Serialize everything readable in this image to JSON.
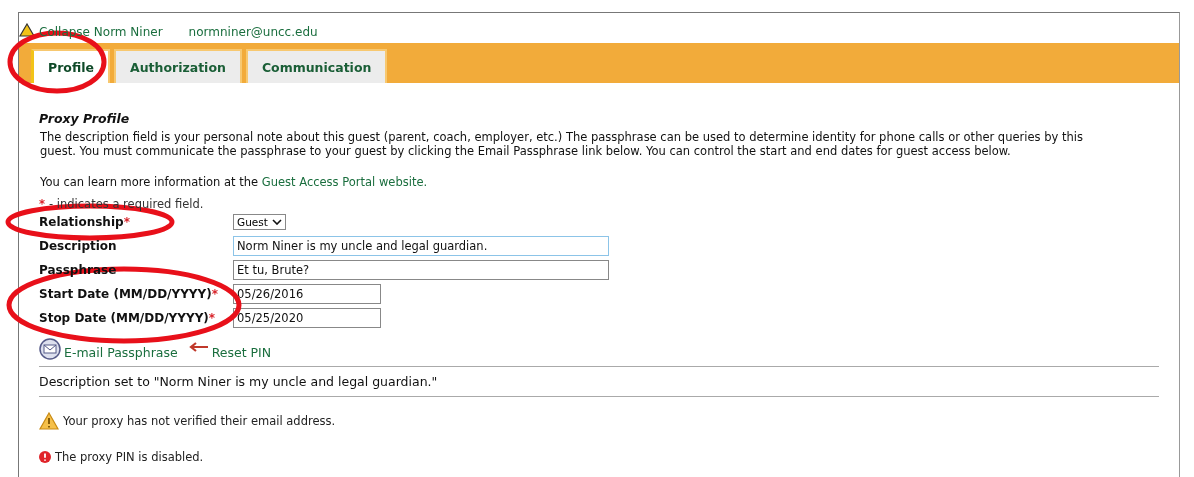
{
  "header": {
    "collapse_label": "Collapse Norm Niner",
    "email": "normniner@uncc.edu"
  },
  "tabs": [
    {
      "label": "Profile",
      "selected": true
    },
    {
      "label": "Authorization",
      "selected": false
    },
    {
      "label": "Communication",
      "selected": false
    }
  ],
  "section_title": "Proxy Profile",
  "intro": "The description field is your personal note about this guest (parent, coach, employer, etc.) The passphrase can be used to determine identity for phone calls or other queries by this guest. You must communicate the passphrase to your guest by clicking the Email Passphrase link below. You can control the start and end dates for guest access below.",
  "learn_more": {
    "text": "You can learn more information at the ",
    "link": "Guest Access Portal website."
  },
  "required_note": {
    "marker": "*",
    "text": "- indicates a required field."
  },
  "fields": [
    {
      "label": "Relationship",
      "required": true,
      "kind": "select",
      "value": "Guest"
    },
    {
      "label": "Description",
      "required": false,
      "kind": "text",
      "value": "Norm Niner is my uncle and legal guardian.",
      "focused": true
    },
    {
      "label": "Passphrase",
      "required": false,
      "kind": "text",
      "value": "Et tu, Brute?",
      "focused": false
    },
    {
      "label": "Start Date (MM/DD/YYYY)",
      "required": true,
      "kind": "date",
      "value": "05/26/2016",
      "focused": false
    },
    {
      "label": "Stop Date (MM/DD/YYYY)",
      "required": true,
      "kind": "date",
      "value": "05/25/2020",
      "focused": false
    }
  ],
  "actions": [
    {
      "label": "E-mail Passphrase",
      "kind": "email"
    },
    {
      "label": "Reset PIN",
      "kind": "reset"
    }
  ],
  "status_message": "Description set to \"Norm Niner is my uncle and legal guardian.\"",
  "notices": [
    {
      "kind": "warning",
      "text": "Your proxy has not verified their email address."
    },
    {
      "kind": "error",
      "text": "The proxy PIN is disabled."
    }
  ]
}
